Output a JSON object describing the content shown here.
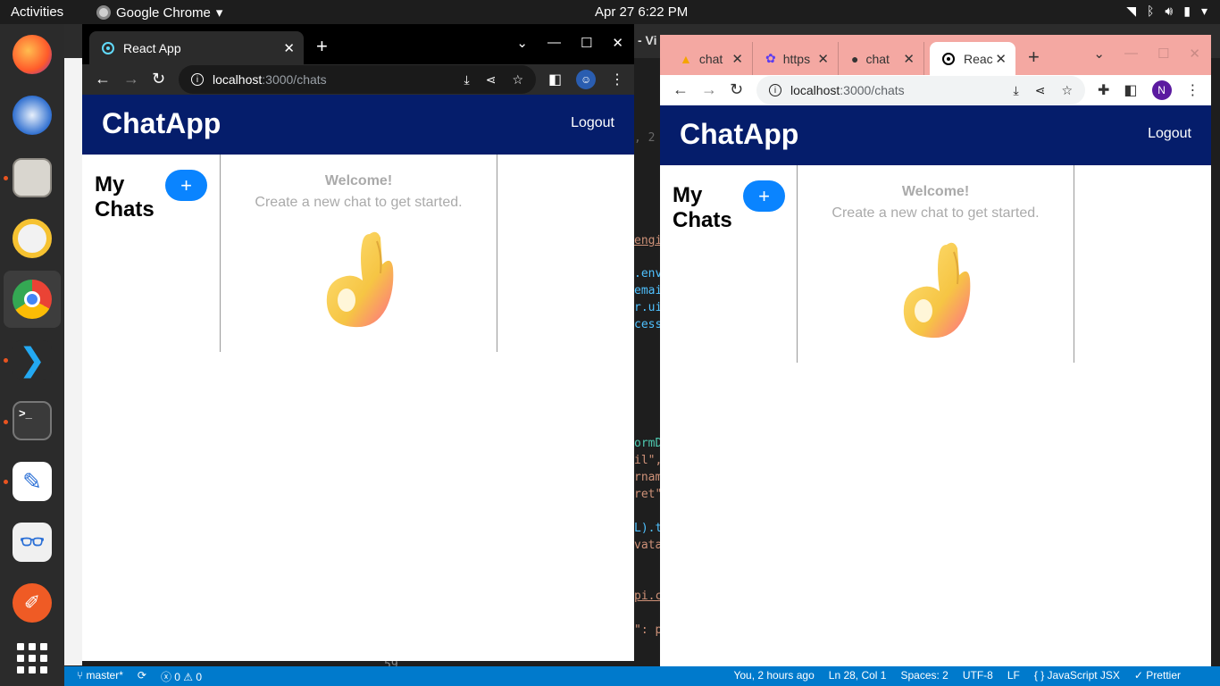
{
  "topbar": {
    "activities": "Activities",
    "app_name": "Google Chrome",
    "clock": "Apr 27  6:22 PM"
  },
  "vscode": {
    "title_fragment": "- Vi",
    "code_fragments": [
      ", 2",
      "engi",
      ".env",
      "emai",
      "r.ui",
      "cess",
      "ormD",
      "il\",",
      "rnam",
      "ret\"",
      "L).t",
      "vata",
      "pi.c",
      "\": p",
      "59"
    ],
    "status_left": [
      "master*",
      "0 ⚠ 0"
    ],
    "status_right": [
      "You, 2 hours ago",
      "Ln 28, Col 1",
      "Spaces: 2",
      "UTF-8",
      "LF",
      "{ } JavaScript JSX",
      "✓ Prettier"
    ]
  },
  "win1": {
    "tab_title": "React App",
    "url_host": "localhost",
    "url_path": ":3000/chats"
  },
  "win2": {
    "tabs": [
      "chat",
      "https",
      "chat",
      "Reac"
    ],
    "url_host": "localhost",
    "url_path": ":3000/chats",
    "avatar_letter": "N"
  },
  "app": {
    "title": "ChatApp",
    "logout": "Logout",
    "my_chats": "My Chats",
    "plus": "+",
    "welcome": "Welcome!",
    "subtitle": "Create a new chat to get started."
  },
  "colors": {
    "header_bg": "#051d6b",
    "button_blue": "#0a84ff",
    "vscode_status": "#007acc",
    "win2_tabstrip": "#f4a8a2"
  }
}
